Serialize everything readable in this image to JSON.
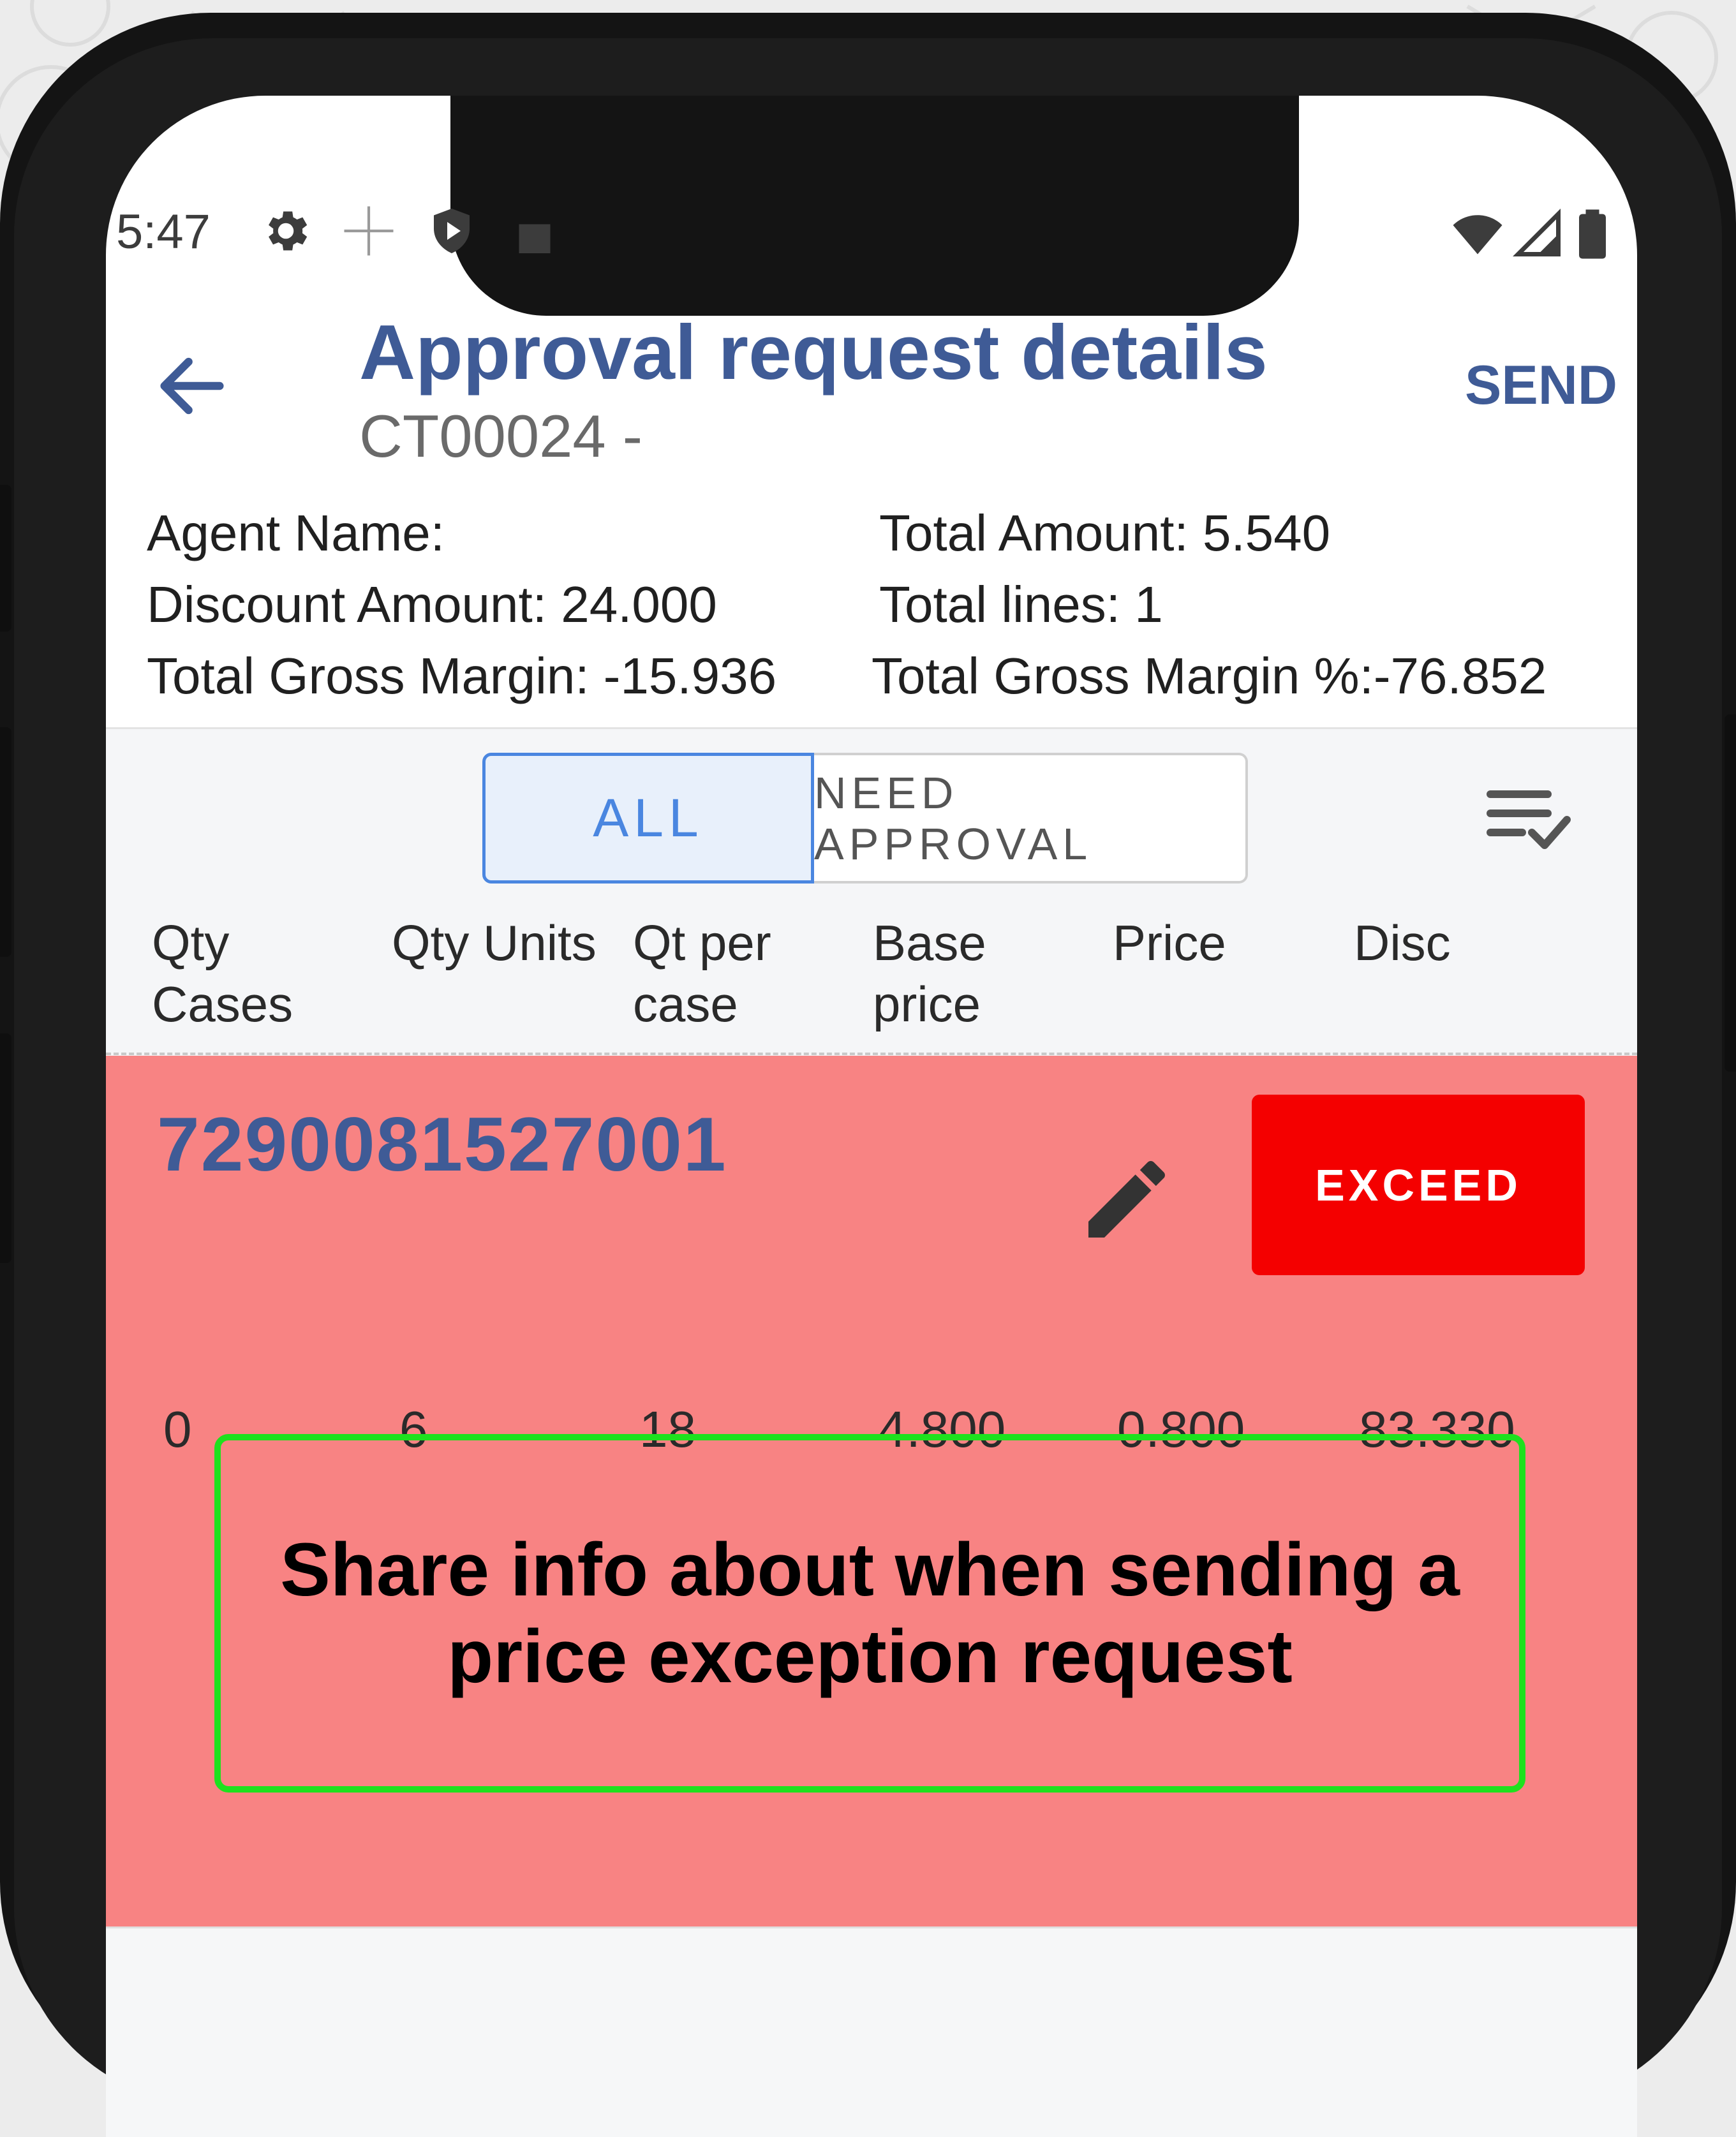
{
  "status_bar": {
    "time": "5:47"
  },
  "app_bar": {
    "title": "Approval request details",
    "subtitle": "CT00024 -",
    "send_label": "SEND"
  },
  "summary": {
    "agent_name": "Agent Name:",
    "discount_amount": "Discount Amount: 24.000",
    "total_gross_margin": "Total Gross Margin: -15.936",
    "total_amount": "Total Amount:  5.540",
    "total_lines": "Total lines:  1",
    "total_gross_margin_pct": "Total Gross Margin %:-76.852"
  },
  "filter": {
    "tabs": [
      {
        "label": "ALL",
        "selected": true
      },
      {
        "label": "NEED APPROVAL",
        "selected": false
      }
    ]
  },
  "table": {
    "headers": [
      {
        "line1": "Qty",
        "line2": "Cases"
      },
      {
        "line1": "Qty Units",
        "line2": ""
      },
      {
        "line1": "Qt per",
        "line2": "case"
      },
      {
        "line1": "Base",
        "line2": "price"
      },
      {
        "line1": "Price",
        "line2": ""
      },
      {
        "line1": "Disc",
        "line2": ""
      }
    ],
    "rows": [
      {
        "code": "7290081527001",
        "status": "EXCEED",
        "values": [
          "0",
          "6",
          "18",
          "4.800",
          "0.800",
          "83.330"
        ]
      }
    ]
  },
  "callout": {
    "text": "Share info about when sending a price exception request"
  },
  "colors": {
    "primary": "#3f5b96",
    "exceed": "#f40000",
    "card_bg": "#f88383",
    "callout_border": "#1ee11e",
    "tab_selected": "#4a86e0"
  }
}
